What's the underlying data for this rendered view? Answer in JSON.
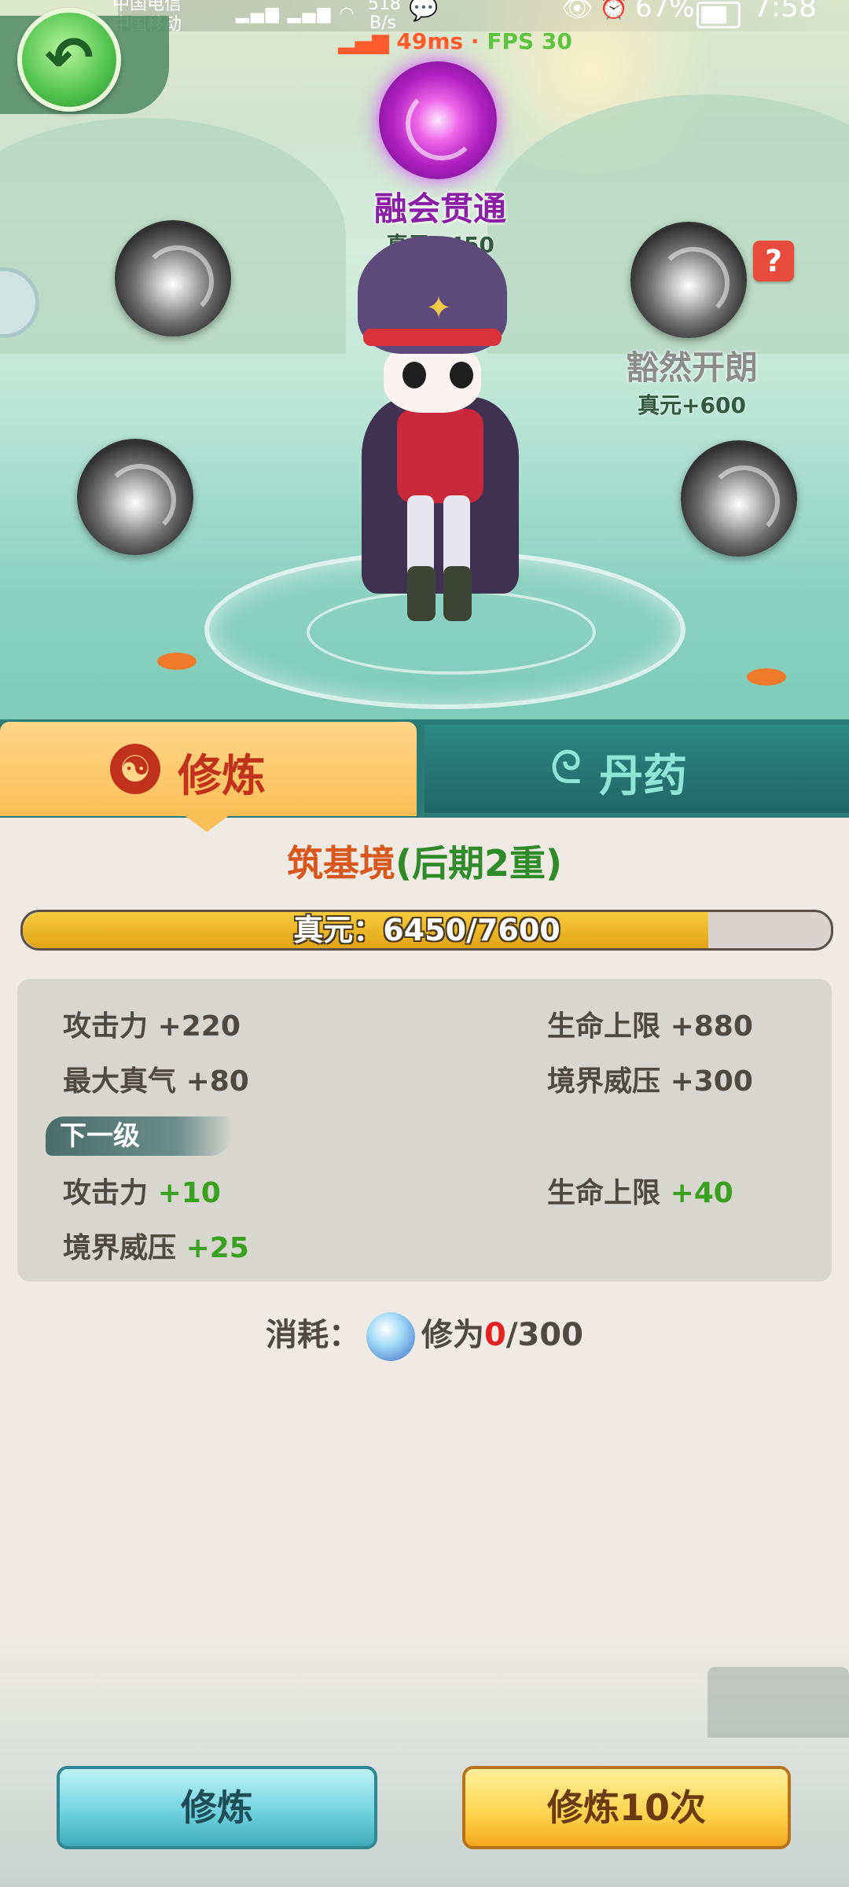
{
  "status_bar": {
    "carrier1": "中国电信",
    "carrier2": "中国移动",
    "net_speed": "518",
    "net_unit": "B/s",
    "battery": "67%",
    "time": "7:58",
    "ping": "49ms",
    "fps": "FPS 30"
  },
  "scene": {
    "active_node": {
      "name": "融会贯通",
      "bonus": "真元+450"
    },
    "next_node": {
      "name": "豁然开朗",
      "bonus": "真元+600"
    },
    "help_label": "?"
  },
  "tabs": [
    {
      "label": "修炼",
      "icon": "yin-yang-icon",
      "active": true
    },
    {
      "label": "丹药",
      "icon": "swirl-icon",
      "active": false
    }
  ],
  "realm": {
    "prefix": "筑基境",
    "suffix": "(后期2重)"
  },
  "progress": {
    "label": "真元：",
    "current": 6450,
    "max": 7600,
    "text": "6450/7600",
    "fraction": 0.8487
  },
  "stats": {
    "current": [
      {
        "label": "攻击力",
        "value": "+220"
      },
      {
        "label": "生命上限",
        "value": "+880"
      },
      {
        "label": "最大真气",
        "value": "+80"
      },
      {
        "label": "境界威压",
        "value": "+300"
      }
    ],
    "next_title": "下一级",
    "next": [
      {
        "label": "攻击力",
        "value": "+10"
      },
      {
        "label": "生命上限",
        "value": "+40"
      },
      {
        "label": "境界威压",
        "value": "+25"
      }
    ]
  },
  "cost": {
    "label": "消耗：",
    "item": "修为",
    "have": "0",
    "need": "/300"
  },
  "buttons": {
    "cultivate": "修炼",
    "cultivate10": "修炼10次"
  },
  "colors": {
    "realm_orange": "#d8571d",
    "stat_green": "#3aa020",
    "accent_purple": "#8a1fa5"
  }
}
